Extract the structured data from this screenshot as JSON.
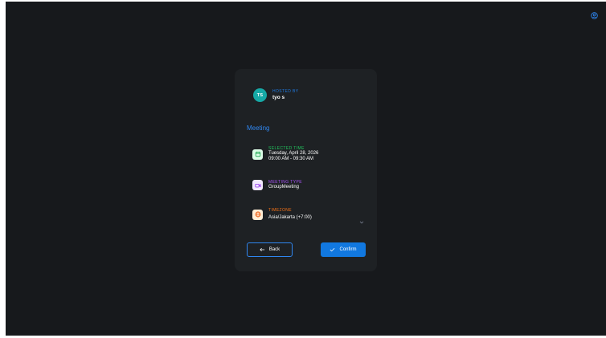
{
  "host": {
    "initials": "TS",
    "label": "HOSTED BY",
    "name": "tyo s"
  },
  "section_title": "Meeting",
  "details": {
    "selected_time": {
      "label": "SELECTED TIME",
      "date": "Tuesday, April 28, 2026",
      "time": "09:00 AM - 09:30 AM",
      "icon": "calendar-icon"
    },
    "meeting_type": {
      "label": "MEETING TYPE",
      "value": "GroupMeeting",
      "icon": "video-icon"
    },
    "timezone": {
      "label": "TIMEZONE",
      "value": "Asia/Jakarta (+7:00)",
      "icon": "globe-icon"
    }
  },
  "actions": {
    "back_label": "Back",
    "confirm_label": "Confirm"
  },
  "colors": {
    "background": "#17191c",
    "card": "#1e2124",
    "accent": "#1178e0",
    "avatar": "#16a9a6",
    "green": "#22c55e",
    "purple": "#a855f7",
    "orange": "#f97316"
  }
}
